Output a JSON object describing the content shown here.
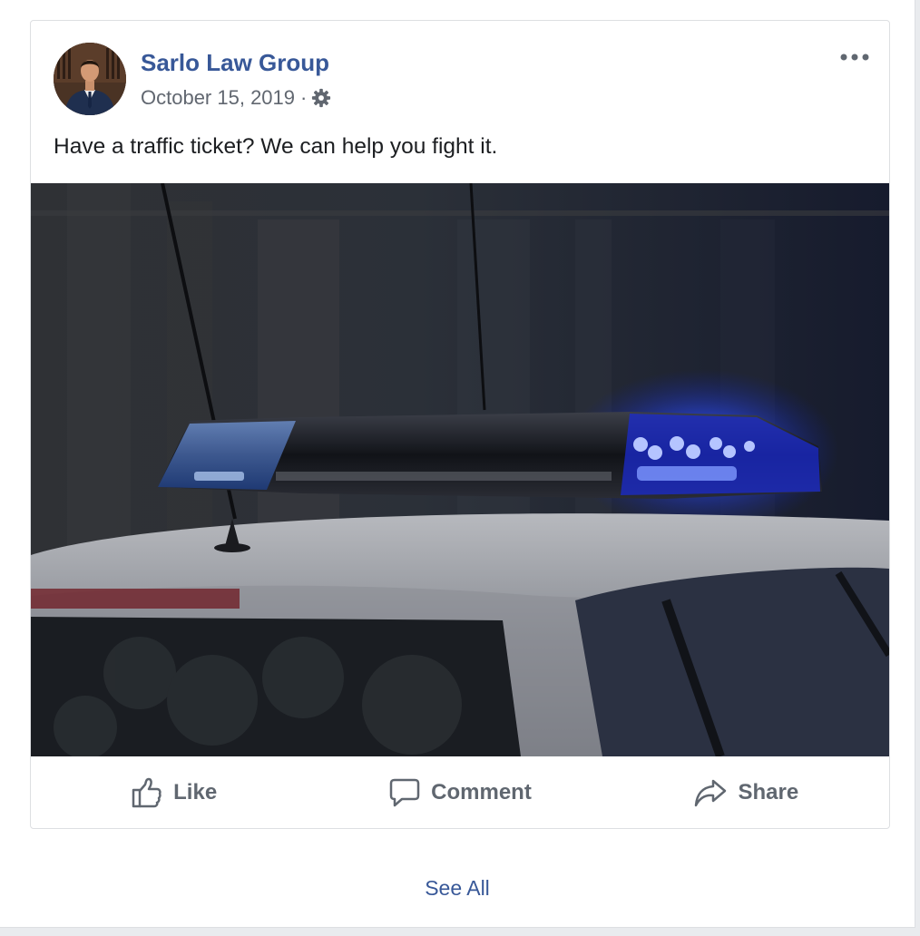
{
  "post": {
    "author": "Sarlo Law Group",
    "date": "October 15, 2019",
    "separator": "·",
    "privacy_icon": "gear-icon",
    "more_icon": "more-options-icon",
    "text": "Have a traffic ticket? We can help you fight it.",
    "photo_icon": "police-car-light-photo"
  },
  "actions": {
    "like": "Like",
    "comment": "Comment",
    "share": "Share"
  },
  "footer": {
    "see_all": "See All"
  },
  "colors": {
    "link": "#385898",
    "meta": "#616770",
    "action": "#606770",
    "border": "#dddfe2"
  }
}
